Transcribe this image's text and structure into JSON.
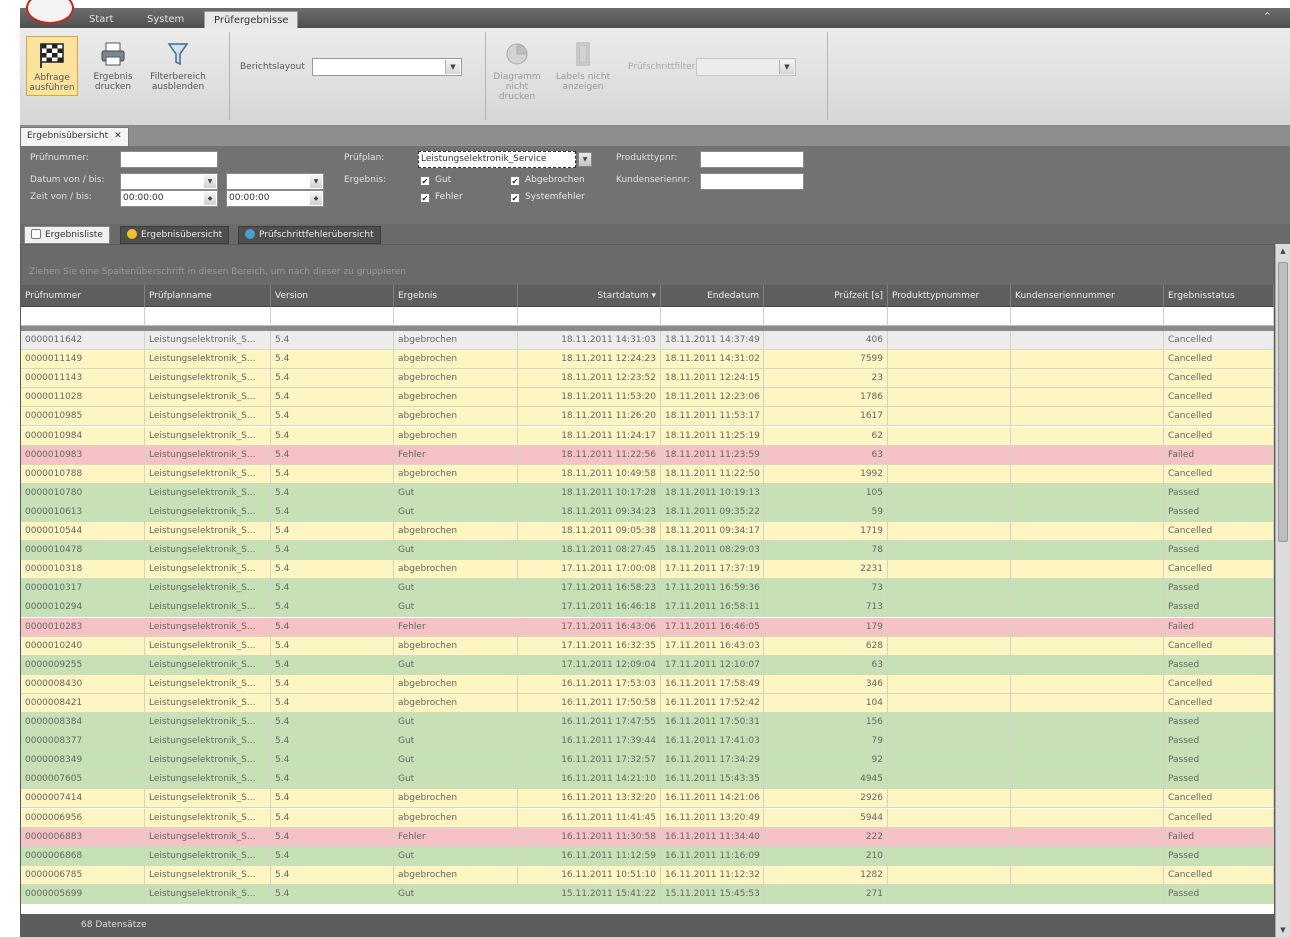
{
  "ribbon_tabs": [
    "Start",
    "System",
    "Prüfergebnisse"
  ],
  "ribbon": {
    "run_query": "Abfrage ausführen",
    "print_result": "Ergebnis drucken",
    "hide_filter": "Filterbereich ausblenden",
    "report_layout_label": "Berichtslayout",
    "report_layout_value": "",
    "diagram_print": "Diagramm nicht drucken",
    "labels_show": "Labels nicht anzeigen",
    "step_filter_label": "Prüfschrittfilter",
    "step_filter_value": ""
  },
  "doc_tab": "Ergebnisübersicht",
  "filter": {
    "pruefnummer_label": "Prüfnummer:",
    "pruefnummer_value": "",
    "datum_label": "Datum von / bis:",
    "zeit_label": "Zeit   von / bis:",
    "zeit_von": "00:00:00",
    "zeit_bis": "00:00:00",
    "pruefplan_label": "Prüfplan:",
    "pruefplan_value": "Leistungselektronik_Service",
    "ergebnis_label": "Ergebnis:",
    "gut": "Gut",
    "fehler": "Fehler",
    "abgebrochen": "Abgebrochen",
    "systemfehler": "Systemfehler",
    "produkttyp_label": "Produkttypnr:",
    "kunden_label": "Kundenseriennr:"
  },
  "view_tabs": [
    "Ergebnisliste",
    "Ergebnisübersicht",
    "Prüfschrittfehlerübersicht"
  ],
  "group_hint": "Ziehen Sie eine Spaltenüberschrift in diesen Bereich, um nach dieser zu gruppieren",
  "columns": [
    "Prüfnummer",
    "Prüfplanname",
    "Version",
    "Ergebnis",
    "Startdatum ▾",
    "Endedatum",
    "Prüfzeit [s]",
    "Produkttypnummer",
    "Kundenseriennummer",
    "Ergebnisstatus"
  ],
  "rows": [
    [
      "0000011642",
      "Leistungselektronik_S...",
      "5.4",
      "abgebrochen",
      "18.11.2011 14:31:03",
      "18.11.2011 14:37:49",
      "406",
      "",
      "",
      "Cancelled"
    ],
    [
      "0000011149",
      "Leistungselektronik_S...",
      "5.4",
      "abgebrochen",
      "18.11.2011 12:24:23",
      "18.11.2011 14:31:02",
      "7599",
      "",
      "",
      "Cancelled"
    ],
    [
      "0000011143",
      "Leistungselektronik_S...",
      "5.4",
      "abgebrochen",
      "18.11.2011 12:23:52",
      "18.11.2011 12:24:15",
      "23",
      "",
      "",
      "Cancelled"
    ],
    [
      "0000011028",
      "Leistungselektronik_S...",
      "5.4",
      "abgebrochen",
      "18.11.2011 11:53:20",
      "18.11.2011 12:23:06",
      "1786",
      "",
      "",
      "Cancelled"
    ],
    [
      "0000010985",
      "Leistungselektronik_S...",
      "5.4",
      "abgebrochen",
      "18.11.2011 11:26:20",
      "18.11.2011 11:53:17",
      "1617",
      "",
      "",
      "Cancelled"
    ],
    [
      "0000010984",
      "Leistungselektronik_S...",
      "5.4",
      "abgebrochen",
      "18.11.2011 11:24:17",
      "18.11.2011 11:25:19",
      "62",
      "",
      "",
      "Cancelled"
    ],
    [
      "0000010983",
      "Leistungselektronik_S...",
      "5.4",
      "Fehler",
      "18.11.2011 11:22:56",
      "18.11.2011 11:23:59",
      "63",
      "",
      "",
      "Failed"
    ],
    [
      "0000010788",
      "Leistungselektronik_S...",
      "5.4",
      "abgebrochen",
      "18.11.2011 10:49:58",
      "18.11.2011 11:22:50",
      "1992",
      "",
      "",
      "Cancelled"
    ],
    [
      "0000010780",
      "Leistungselektronik_S...",
      "5.4",
      "Gut",
      "18.11.2011 10:17:28",
      "18.11.2011 10:19:13",
      "105",
      "",
      "",
      "Passed"
    ],
    [
      "0000010613",
      "Leistungselektronik_S...",
      "5.4",
      "Gut",
      "18.11.2011 09:34:23",
      "18.11.2011 09:35:22",
      "59",
      "",
      "",
      "Passed"
    ],
    [
      "0000010544",
      "Leistungselektronik_S...",
      "5.4",
      "abgebrochen",
      "18.11.2011 09:05:38",
      "18.11.2011 09:34:17",
      "1719",
      "",
      "",
      "Cancelled"
    ],
    [
      "0000010478",
      "Leistungselektronik_S...",
      "5.4",
      "Gut",
      "18.11.2011 08:27:45",
      "18.11.2011 08:29:03",
      "78",
      "",
      "",
      "Passed"
    ],
    [
      "0000010318",
      "Leistungselektronik_S...",
      "5.4",
      "abgebrochen",
      "17.11.2011 17:00:08",
      "17.11.2011 17:37:19",
      "2231",
      "",
      "",
      "Cancelled"
    ],
    [
      "0000010317",
      "Leistungselektronik_S...",
      "5.4",
      "Gut",
      "17.11.2011 16:58:23",
      "17.11.2011 16:59:36",
      "73",
      "",
      "",
      "Passed"
    ],
    [
      "0000010294",
      "Leistungselektronik_S...",
      "5.4",
      "Gut",
      "17.11.2011 16:46:18",
      "17.11.2011 16:58:11",
      "713",
      "",
      "",
      "Passed"
    ],
    [
      "0000010283",
      "Leistungselektronik_S...",
      "5.4",
      "Fehler",
      "17.11.2011 16:43:06",
      "17.11.2011 16:46:05",
      "179",
      "",
      "",
      "Failed"
    ],
    [
      "0000010240",
      "Leistungselektronik_S...",
      "5.4",
      "abgebrochen",
      "17.11.2011 16:32:35",
      "17.11.2011 16:43:03",
      "628",
      "",
      "",
      "Cancelled"
    ],
    [
      "0000009255",
      "Leistungselektronik_S...",
      "5.4",
      "Gut",
      "17.11.2011 12:09:04",
      "17.11.2011 12:10:07",
      "63",
      "",
      "",
      "Passed"
    ],
    [
      "0000008430",
      "Leistungselektronik_S...",
      "5.4",
      "abgebrochen",
      "16.11.2011 17:53:03",
      "16.11.2011 17:58:49",
      "346",
      "",
      "",
      "Cancelled"
    ],
    [
      "0000008421",
      "Leistungselektronik_S...",
      "5.4",
      "abgebrochen",
      "16.11.2011 17:50:58",
      "16.11.2011 17:52:42",
      "104",
      "",
      "",
      "Cancelled"
    ],
    [
      "0000008384",
      "Leistungselektronik_S...",
      "5.4",
      "Gut",
      "16.11.2011 17:47:55",
      "16.11.2011 17:50:31",
      "156",
      "",
      "",
      "Passed"
    ],
    [
      "0000008377",
      "Leistungselektronik_S...",
      "5.4",
      "Gut",
      "16.11.2011 17:39:44",
      "16.11.2011 17:41:03",
      "79",
      "",
      "",
      "Passed"
    ],
    [
      "0000008349",
      "Leistungselektronik_S...",
      "5.4",
      "Gut",
      "16.11.2011 17:32:57",
      "16.11.2011 17:34:29",
      "92",
      "",
      "",
      "Passed"
    ],
    [
      "0000007605",
      "Leistungselektronik_S...",
      "5.4",
      "Gut",
      "16.11.2011 14:21:10",
      "16.11.2011 15:43:35",
      "4945",
      "",
      "",
      "Passed"
    ],
    [
      "0000007414",
      "Leistungselektronik_S...",
      "5.4",
      "abgebrochen",
      "16.11.2011 13:32:20",
      "16.11.2011 14:21:06",
      "2926",
      "",
      "",
      "Cancelled"
    ],
    [
      "0000006956",
      "Leistungselektronik_S...",
      "5.4",
      "abgebrochen",
      "16.11.2011 11:41:45",
      "16.11.2011 13:20:49",
      "5944",
      "",
      "",
      "Cancelled"
    ],
    [
      "0000006883",
      "Leistungselektronik_S...",
      "5.4",
      "Fehler",
      "16.11.2011 11:30:58",
      "16.11.2011 11:34:40",
      "222",
      "",
      "",
      "Failed"
    ],
    [
      "0000006868",
      "Leistungselektronik_S...",
      "5.4",
      "Gut",
      "16.11.2011 11:12:59",
      "16.11.2011 11:16:09",
      "210",
      "",
      "",
      "Passed"
    ],
    [
      "0000006785",
      "Leistungselektronik_S...",
      "5.4",
      "abgebrochen",
      "16.11.2011 10:51:10",
      "16.11.2011 11:12:32",
      "1282",
      "",
      "",
      "Cancelled"
    ],
    [
      "0000005699",
      "Leistungselektronik_S...",
      "5.4",
      "Gut",
      "15.11.2011 15:41:22",
      "15.11.2011 15:45:53",
      "271",
      "",
      "",
      "Passed"
    ]
  ],
  "status_colors": {
    "Cancelled": "#fdf5c2",
    "Passed": "#c6e1b6",
    "Failed": "#f5c2c6"
  },
  "footer": "68 Datensätze"
}
